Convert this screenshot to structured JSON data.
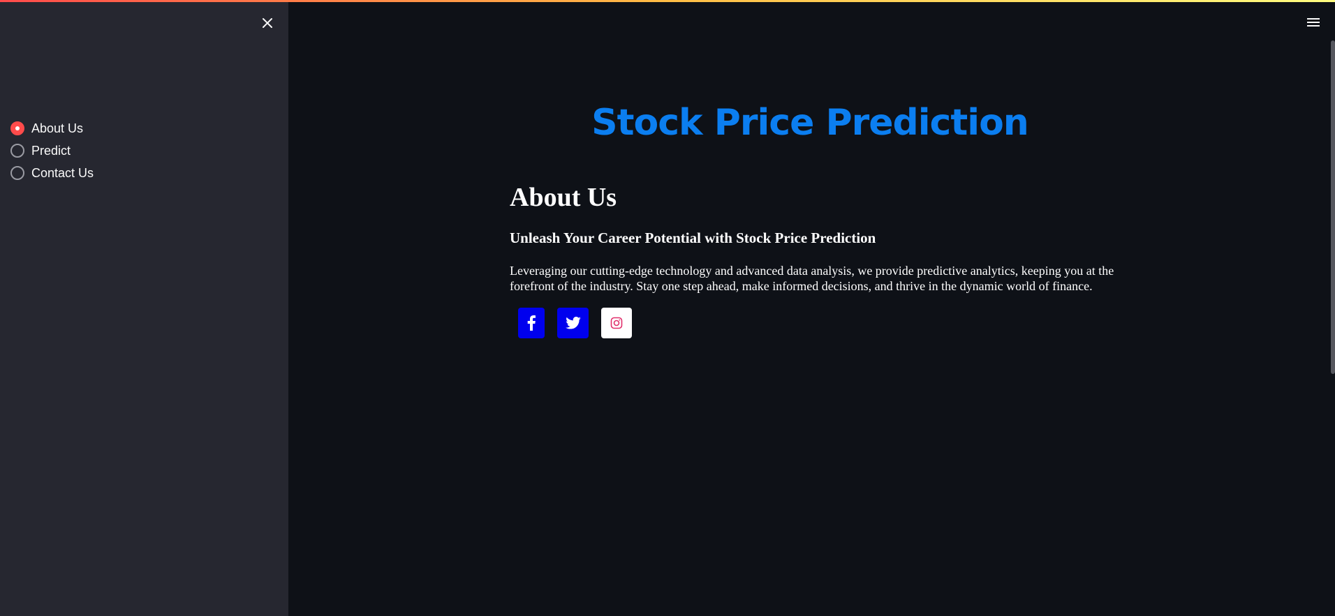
{
  "sidebar": {
    "nav_options": [
      {
        "label": "About Us",
        "selected": true
      },
      {
        "label": "Predict",
        "selected": false
      },
      {
        "label": "Contact Us",
        "selected": false
      }
    ]
  },
  "main": {
    "app_title": "Stock Price Prediction",
    "section": {
      "title": "About Us",
      "subtitle": "Unleash Your Career Potential with Stock Price Prediction",
      "text": "Leveraging our cutting-edge technology and advanced data analysis, we provide predictive analytics, keeping you at the forefront of the industry. Stay one step ahead, make informed decisions, and thrive in the dynamic world of finance."
    },
    "social_links": [
      {
        "name": "facebook",
        "icon": "facebook-icon"
      },
      {
        "name": "twitter",
        "icon": "twitter-icon"
      },
      {
        "name": "instagram",
        "icon": "instagram-icon"
      }
    ]
  },
  "colors": {
    "accent": "#ff4b4b",
    "title_blue": "#0b7ef0",
    "sidebar_bg": "#262730",
    "main_bg": "#0e1117",
    "social_blue": "#0000ee",
    "instagram_pink": "#e1306c"
  }
}
